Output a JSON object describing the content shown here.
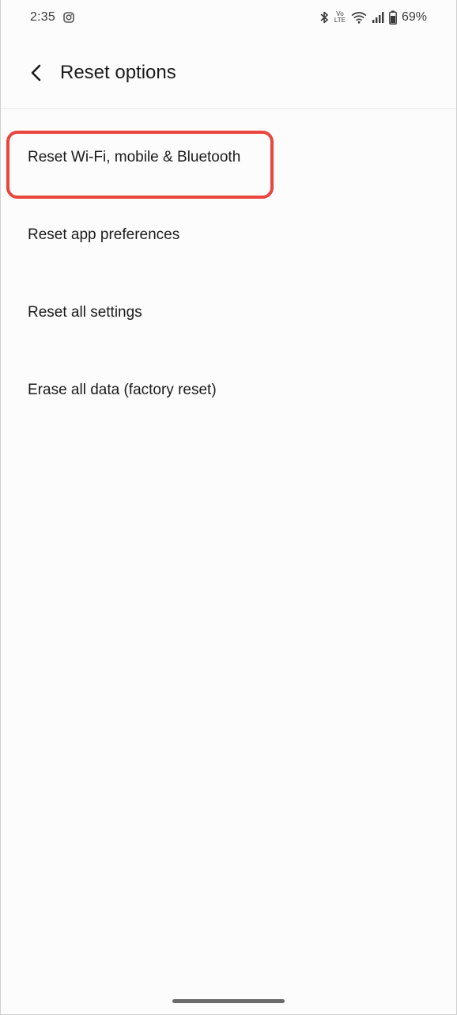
{
  "status_bar": {
    "time": "2:35",
    "network_badge": "Vo LTE",
    "battery_percent": "69%",
    "icons": [
      "instagram-icon",
      "bluetooth-icon",
      "volte-icon",
      "wifi-icon",
      "cell-signal-icon",
      "battery-icon"
    ]
  },
  "header": {
    "back_icon": "chevron-left-icon",
    "title": "Reset options"
  },
  "options": [
    {
      "label": "Reset Wi-Fi, mobile & Bluetooth",
      "highlighted": true
    },
    {
      "label": "Reset app preferences"
    },
    {
      "label": "Reset all settings"
    },
    {
      "label": "Erase all data (factory reset)"
    }
  ],
  "colors": {
    "background": "#fcfcfc",
    "text": "#1b1b1b",
    "highlight": "#e8453c"
  }
}
